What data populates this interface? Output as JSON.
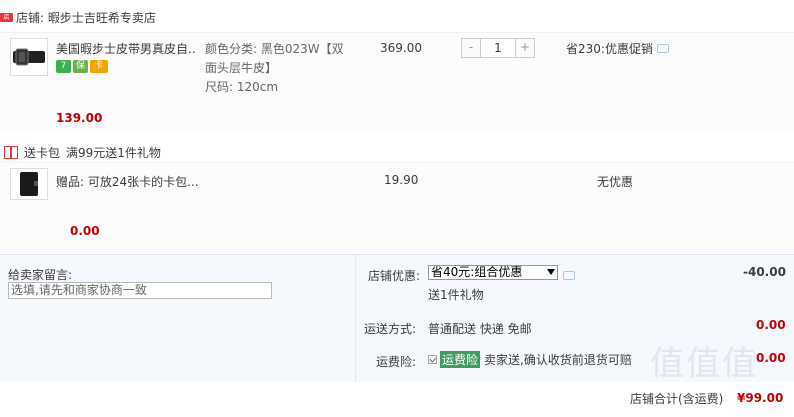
{
  "shop": {
    "label": "店铺: 暇步士吉旺希专卖店"
  },
  "item": {
    "title": "美国暇步士皮带男真皮自...",
    "badges": [
      "7",
      "保",
      "卡"
    ],
    "sku_color": "颜色分类: 黑色023W【双面头层牛皮】",
    "sku_size": "尺码: 120cm",
    "unit_price": "369.00",
    "quantity": "1",
    "qty_minus": "-",
    "qty_plus": "+",
    "promo": "省230:优惠促销",
    "subtotal": "139.00"
  },
  "gift_section": {
    "title": "送卡包",
    "rule": "满99元送1件礼物"
  },
  "gift_item": {
    "title": "赠品: 可放24张卡的卡包...",
    "unit_price": "19.90",
    "promo": "无优惠",
    "subtotal": "0.00"
  },
  "order": {
    "message_label": "给卖家留言:",
    "message_placeholder": "选填,请先和商家协商一致",
    "shop_discount_label": "店铺优惠:",
    "shop_discount_option": "省40元:组合优惠",
    "shop_discount_amount": "-40.00",
    "shop_discount_gift": "送1件礼物",
    "shipping_label": "运送方式:",
    "shipping_value": "普通配送 快递 免邮",
    "shipping_amount": "0.00",
    "insurance_label": "运费险:",
    "insurance_tag": "运费险",
    "insurance_text": "卖家送,确认收货前退货可赔",
    "insurance_amount": "0.00",
    "total_label": "店铺合计(含运费)",
    "total_value": "¥99.00"
  },
  "watermark": "值值值"
}
